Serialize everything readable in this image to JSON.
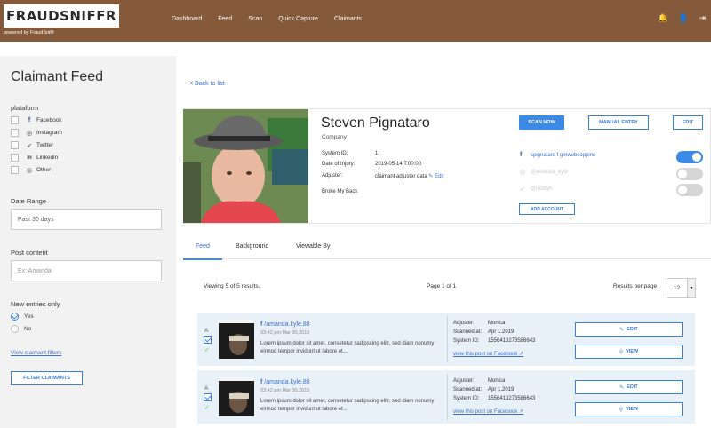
{
  "brand": {
    "logo": "FRAUDSNIFFR",
    "powered_by": "powered by FraudSniffr"
  },
  "nav": {
    "items": [
      "Dashboard",
      "Feed",
      "Scan",
      "Quick Capture",
      "Claimants"
    ],
    "icons": [
      "bell-icon",
      "user-icon",
      "logout-icon"
    ]
  },
  "sidebar": {
    "title": "Claimant Feed",
    "platforms_label": "plataform",
    "platforms": [
      {
        "label": "Facebook",
        "icon": "f"
      },
      {
        "label": "Instagram",
        "icon": "◎"
      },
      {
        "label": "Twitter",
        "icon": "🐦"
      },
      {
        "label": "Linkedin",
        "icon": "in"
      },
      {
        "label": "Other",
        "icon": "◎"
      }
    ],
    "date_range_label": "Date Range",
    "date_range_value": "Past 30 days",
    "post_content_label": "Post content",
    "post_content_placeholder": "Ex: Amanda",
    "new_entries_label": "New entries only",
    "yes_label": "Yes",
    "no_label": "No",
    "view_filters_link": "View claimant filters",
    "filter_button": "FILTER CLAIMANTS"
  },
  "main": {
    "back_link": "< Back to list",
    "profile": {
      "name": "Steven Pignataro",
      "company": "Company",
      "system_id_label": "System ID:",
      "system_id_value": "1",
      "date_of_injury_label": "Date of Injury:",
      "date_of_injury_value": "2019-05-14 T:00:00",
      "adjuster_label": "Adjuster:",
      "adjuster_value": "claimant adjuster data",
      "edit_link": "Edit",
      "injury_note": "Broke My Back"
    },
    "actions": {
      "scan_now": "SCAN NOW",
      "manual_entry": "MANUAL ENTRY",
      "edit": "EDIT",
      "add_account": "ADD ACCOUNT"
    },
    "accounts": [
      {
        "text": "spignataro  f  gmwebcoppine",
        "active": true
      },
      {
        "text": "@amanda_kyle",
        "active": false
      },
      {
        "text": "@reddyh",
        "active": false
      }
    ],
    "tabs": [
      "Feed",
      "Background",
      "Viewable By"
    ],
    "results": {
      "summary": "Viewing 5 of 5 results.",
      "page": "Page 1 of 1",
      "per_page_label": "Results per page",
      "per_page_value": "12"
    },
    "feed": [
      {
        "marker": "A",
        "user": "/amanda.kyle.88",
        "time": "03:42 pm Mar 30,2019",
        "body": "Lorem ipsum dolor sit amet, consetetur sadipscing elitr, sed diam nonumy eirmod tempor invidunt ut labore et...",
        "adjuster_label": "Adjuster:",
        "adjuster": "Monica",
        "scanned_label": "Scanned at:",
        "scanned": "Apr 1.2019",
        "sysid_label": "System ID:",
        "sysid": "1556413273586643",
        "fb_link": "view this post on Facebook ↗",
        "edit": "EDIT",
        "view": "VIEW"
      },
      {
        "marker": "A",
        "user": "/amanda.kyle.88",
        "time": "03:42 pm Mar 30,2019",
        "body": "Lorem ipsum dolor sit amet, consetetur sadipscing elitr, sed diam nonumy eirmod tempor invidunt ut labore et...",
        "adjuster_label": "Adjuster:",
        "adjuster": "Monica",
        "scanned_label": "Scanned at:",
        "scanned": "Apr 1.2019",
        "sysid_label": "System ID:",
        "sysid": "1556413273586643",
        "fb_link": "view this post on Facebook ↗",
        "edit": "EDIT",
        "view": "VIEW"
      }
    ]
  },
  "colors": {
    "header": "#855a3a",
    "accent": "#3b8ae6",
    "sidebar_bg": "#f2f2f2",
    "row_bg": "#e9f1f8"
  }
}
